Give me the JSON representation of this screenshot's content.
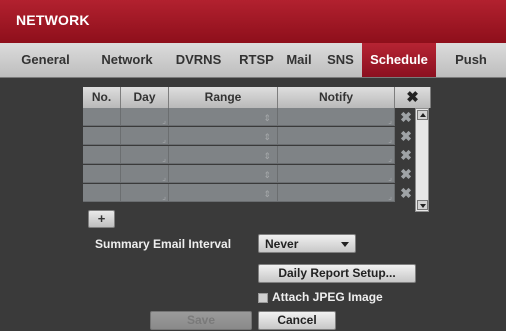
{
  "window": {
    "title": "NETWORK"
  },
  "tabs": [
    {
      "label": "General"
    },
    {
      "label": "Network"
    },
    {
      "label": "DVRNS"
    },
    {
      "label": "RTSP"
    },
    {
      "label": "Mail"
    },
    {
      "label": "SNS"
    },
    {
      "label": "Schedule",
      "active": true
    },
    {
      "label": "Push"
    }
  ],
  "schedule": {
    "headers": {
      "no": "No.",
      "day": "Day",
      "range": "Range",
      "notify": "Notify",
      "delete": "✖"
    },
    "rows": [
      {
        "no": "",
        "day": "",
        "range": "",
        "notify": ""
      },
      {
        "no": "",
        "day": "",
        "range": "",
        "notify": ""
      },
      {
        "no": "",
        "day": "",
        "range": "",
        "notify": ""
      },
      {
        "no": "",
        "day": "",
        "range": "",
        "notify": ""
      },
      {
        "no": "",
        "day": "",
        "range": "",
        "notify": ""
      }
    ],
    "add_label": "+"
  },
  "summary": {
    "label": "Summary Email Interval",
    "value": "Never"
  },
  "daily_report_label": "Daily Report Setup...",
  "attach_jpeg_label": "Attach JPEG Image",
  "save_label": "Save",
  "cancel_label": "Cancel",
  "colors": {
    "accent": "#a11a2a",
    "background": "#3a3a3a"
  },
  "icons": {
    "delete": "close-icon",
    "scroll_up": "chevron-up-icon",
    "scroll_down": "chevron-down-icon",
    "dropdown": "chevron-down-icon"
  }
}
